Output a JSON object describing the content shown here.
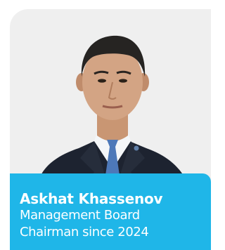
{
  "person": {
    "name": "Askhat Khassenov",
    "role_line1": "Management Board",
    "role_line2": "Chairman since 2024"
  },
  "colors": {
    "card_background": "#efefef",
    "caption_background": "#1fb6e8",
    "caption_text": "#ffffff"
  }
}
